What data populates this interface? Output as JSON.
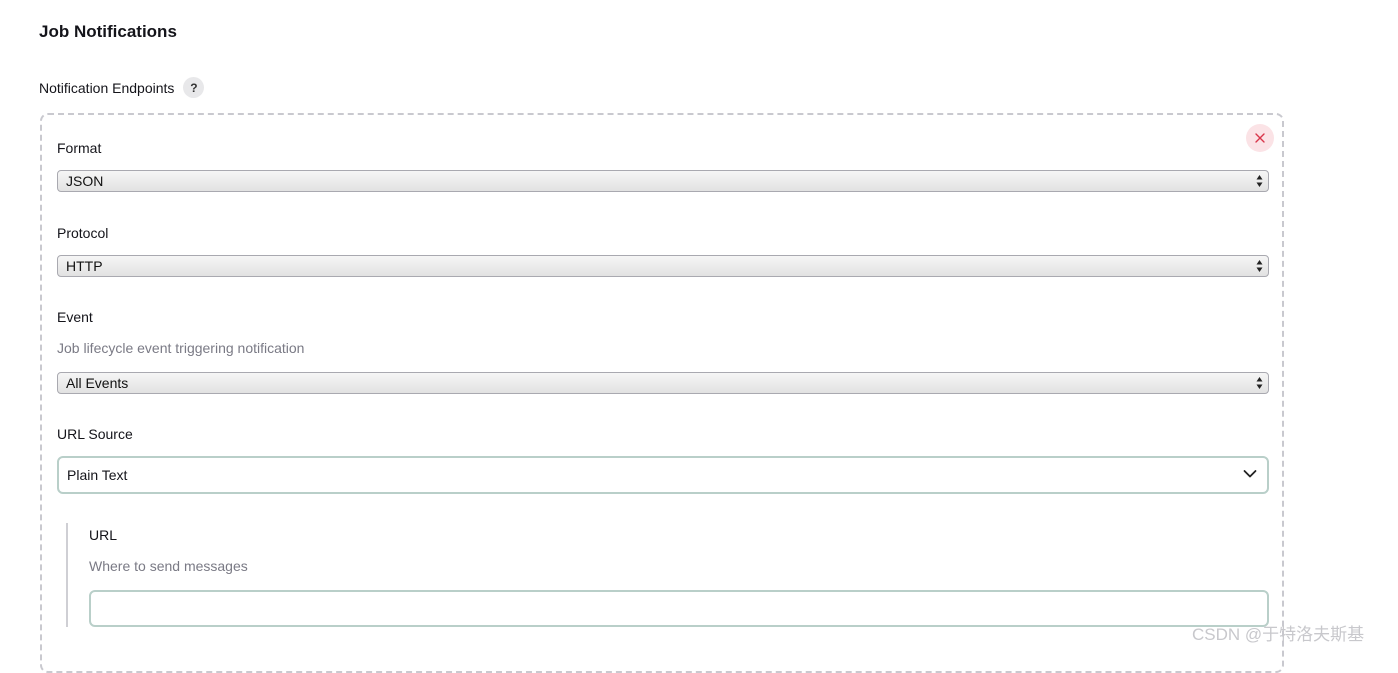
{
  "section": {
    "title": "Job Notifications"
  },
  "endpoints": {
    "label": "Notification Endpoints",
    "help_icon": "?"
  },
  "delete_button": {
    "icon": "close-icon",
    "color": "#d9364a"
  },
  "fields": {
    "format": {
      "label": "Format",
      "value": "JSON"
    },
    "protocol": {
      "label": "Protocol",
      "value": "HTTP"
    },
    "event": {
      "label": "Event",
      "description": "Job lifecycle event triggering notification",
      "value": "All Events"
    },
    "url_source": {
      "label": "URL Source",
      "value": "Plain Text"
    },
    "url": {
      "label": "URL",
      "description": "Where to send messages",
      "value": ""
    }
  },
  "watermark": "CSDN @于特洛夫斯基"
}
